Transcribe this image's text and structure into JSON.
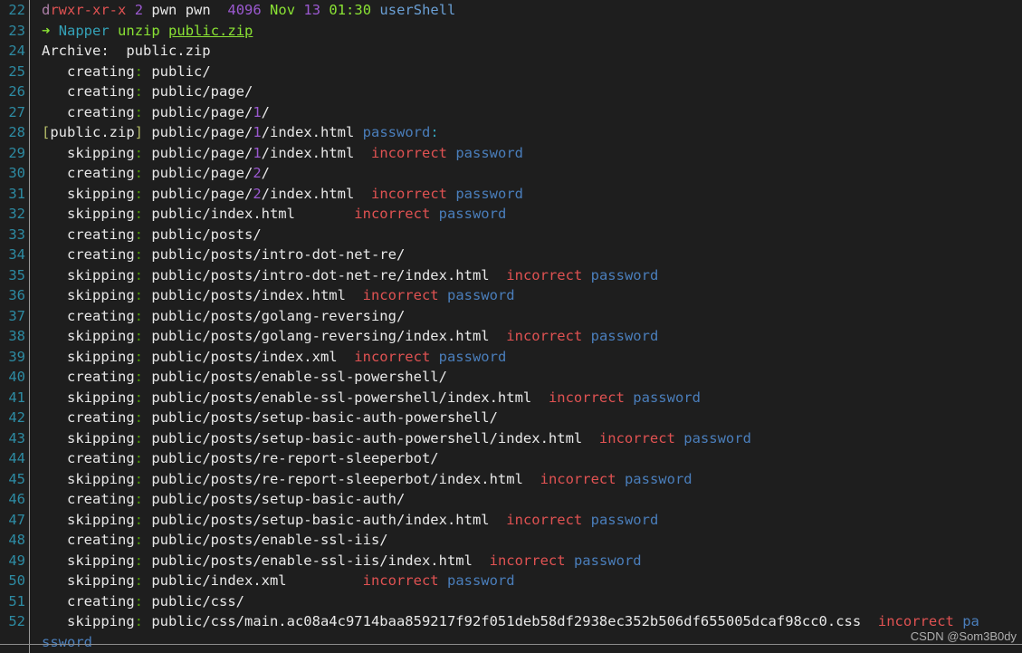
{
  "terminal": {
    "background_color": "#1e1e1e",
    "gutter_separator_color": "#9a9a9a",
    "line_number_color": "#2d8ba3",
    "watermark": "CSDN @Som3B0dy",
    "first_line_number": 22,
    "last_line_number": 52,
    "wrapped_remainder": "ssword",
    "prompt": {
      "arrow": "➜",
      "host": "Napper",
      "command": "unzip",
      "argument": "public.zip"
    },
    "lines": [
      {
        "n": "22",
        "type": "ls-listing",
        "segments": [
          {
            "t": "d",
            "c": "c-magenta"
          },
          {
            "t": "rwxr-xr-x",
            "c": "c-red"
          },
          {
            "t": " ",
            "c": "c-white"
          },
          {
            "t": "2",
            "c": "c-purple"
          },
          {
            "t": " pwn pwn  ",
            "c": "c-white"
          },
          {
            "t": "4096",
            "c": "c-purple"
          },
          {
            "t": " ",
            "c": "c-white"
          },
          {
            "t": "Nov",
            "c": "c-lgreen"
          },
          {
            "t": " ",
            "c": "c-white"
          },
          {
            "t": "13",
            "c": "c-purple"
          },
          {
            "t": " ",
            "c": "c-white"
          },
          {
            "t": "01:30",
            "c": "c-lgreen"
          },
          {
            "t": " ",
            "c": "c-white"
          },
          {
            "t": "userShell",
            "c": "c-lblue"
          }
        ]
      },
      {
        "n": "23",
        "type": "prompt",
        "segments": [
          {
            "t": "➜",
            "c": "c-lgreen"
          },
          {
            "t": " ",
            "c": "c-white"
          },
          {
            "t": "Napper",
            "c": "c-cyan"
          },
          {
            "t": " ",
            "c": "c-white"
          },
          {
            "t": "unzip",
            "c": "c-lgreen"
          },
          {
            "t": " ",
            "c": "c-white"
          },
          {
            "t": "public.zip",
            "c": "c-lgreen underline"
          }
        ]
      },
      {
        "n": "24",
        "type": "archive",
        "segments": [
          {
            "t": "Archive:  public.zip",
            "c": "c-white"
          }
        ]
      },
      {
        "n": "25",
        "type": "creating",
        "segments": [
          {
            "t": "   creating",
            "c": "c-white"
          },
          {
            "t": ":",
            "c": "c-green"
          },
          {
            "t": " public/",
            "c": "c-white"
          }
        ]
      },
      {
        "n": "26",
        "type": "creating",
        "segments": [
          {
            "t": "   creating",
            "c": "c-white"
          },
          {
            "t": ":",
            "c": "c-green"
          },
          {
            "t": " public/page/",
            "c": "c-white"
          }
        ]
      },
      {
        "n": "27",
        "type": "creating",
        "segments": [
          {
            "t": "   creating",
            "c": "c-white"
          },
          {
            "t": ":",
            "c": "c-green"
          },
          {
            "t": " public/page/",
            "c": "c-white"
          },
          {
            "t": "1",
            "c": "c-purple"
          },
          {
            "t": "/",
            "c": "c-white"
          }
        ]
      },
      {
        "n": "28",
        "type": "password-prompt",
        "segments": [
          {
            "t": "[",
            "c": "c-olive"
          },
          {
            "t": "public.zip",
            "c": "c-white"
          },
          {
            "t": "]",
            "c": "c-olive"
          },
          {
            "t": " public/page/",
            "c": "c-white"
          },
          {
            "t": "1",
            "c": "c-purple"
          },
          {
            "t": "/index.html ",
            "c": "c-white"
          },
          {
            "t": "password",
            "c": "c-blue"
          },
          {
            "t": ":",
            "c": "c-cyan"
          }
        ]
      },
      {
        "n": "29",
        "type": "skipping",
        "segments": [
          {
            "t": "   skipping",
            "c": "c-white"
          },
          {
            "t": ":",
            "c": "c-green"
          },
          {
            "t": " public/page/",
            "c": "c-white"
          },
          {
            "t": "1",
            "c": "c-purple"
          },
          {
            "t": "/index.html  ",
            "c": "c-white"
          },
          {
            "t": "incorrect",
            "c": "c-red"
          },
          {
            "t": " ",
            "c": "c-white"
          },
          {
            "t": "password",
            "c": "c-blue"
          }
        ]
      },
      {
        "n": "30",
        "type": "creating",
        "segments": [
          {
            "t": "   creating",
            "c": "c-white"
          },
          {
            "t": ":",
            "c": "c-green"
          },
          {
            "t": " public/page/",
            "c": "c-white"
          },
          {
            "t": "2",
            "c": "c-purple"
          },
          {
            "t": "/",
            "c": "c-white"
          }
        ]
      },
      {
        "n": "31",
        "type": "skipping",
        "segments": [
          {
            "t": "   skipping",
            "c": "c-white"
          },
          {
            "t": ":",
            "c": "c-green"
          },
          {
            "t": " public/page/",
            "c": "c-white"
          },
          {
            "t": "2",
            "c": "c-purple"
          },
          {
            "t": "/index.html  ",
            "c": "c-white"
          },
          {
            "t": "incorrect",
            "c": "c-red"
          },
          {
            "t": " ",
            "c": "c-white"
          },
          {
            "t": "password",
            "c": "c-blue"
          }
        ]
      },
      {
        "n": "32",
        "type": "skipping",
        "segments": [
          {
            "t": "   skipping",
            "c": "c-white"
          },
          {
            "t": ":",
            "c": "c-green"
          },
          {
            "t": " public/index.html       ",
            "c": "c-white"
          },
          {
            "t": "incorrect",
            "c": "c-red"
          },
          {
            "t": " ",
            "c": "c-white"
          },
          {
            "t": "password",
            "c": "c-blue"
          }
        ]
      },
      {
        "n": "33",
        "type": "creating",
        "segments": [
          {
            "t": "   creating",
            "c": "c-white"
          },
          {
            "t": ":",
            "c": "c-green"
          },
          {
            "t": " public/posts/",
            "c": "c-white"
          }
        ]
      },
      {
        "n": "34",
        "type": "creating",
        "segments": [
          {
            "t": "   creating",
            "c": "c-white"
          },
          {
            "t": ":",
            "c": "c-green"
          },
          {
            "t": " public/posts/intro-dot-net-re/",
            "c": "c-white"
          }
        ]
      },
      {
        "n": "35",
        "type": "skipping",
        "segments": [
          {
            "t": "   skipping",
            "c": "c-white"
          },
          {
            "t": ":",
            "c": "c-green"
          },
          {
            "t": " public/posts/intro-dot-net-re/index.html  ",
            "c": "c-white"
          },
          {
            "t": "incorrect",
            "c": "c-red"
          },
          {
            "t": " ",
            "c": "c-white"
          },
          {
            "t": "password",
            "c": "c-blue"
          }
        ]
      },
      {
        "n": "36",
        "type": "skipping",
        "segments": [
          {
            "t": "   skipping",
            "c": "c-white"
          },
          {
            "t": ":",
            "c": "c-green"
          },
          {
            "t": " public/posts/index.html  ",
            "c": "c-white"
          },
          {
            "t": "incorrect",
            "c": "c-red"
          },
          {
            "t": " ",
            "c": "c-white"
          },
          {
            "t": "password",
            "c": "c-blue"
          }
        ]
      },
      {
        "n": "37",
        "type": "creating",
        "segments": [
          {
            "t": "   creating",
            "c": "c-white"
          },
          {
            "t": ":",
            "c": "c-green"
          },
          {
            "t": " public/posts/golang-reversing/",
            "c": "c-white"
          }
        ]
      },
      {
        "n": "38",
        "type": "skipping",
        "segments": [
          {
            "t": "   skipping",
            "c": "c-white"
          },
          {
            "t": ":",
            "c": "c-green"
          },
          {
            "t": " public/posts/golang-reversing/index.html  ",
            "c": "c-white"
          },
          {
            "t": "incorrect",
            "c": "c-red"
          },
          {
            "t": " ",
            "c": "c-white"
          },
          {
            "t": "password",
            "c": "c-blue"
          }
        ]
      },
      {
        "n": "39",
        "type": "skipping",
        "segments": [
          {
            "t": "   skipping",
            "c": "c-white"
          },
          {
            "t": ":",
            "c": "c-green"
          },
          {
            "t": " public/posts/index.xml  ",
            "c": "c-white"
          },
          {
            "t": "incorrect",
            "c": "c-red"
          },
          {
            "t": " ",
            "c": "c-white"
          },
          {
            "t": "password",
            "c": "c-blue"
          }
        ]
      },
      {
        "n": "40",
        "type": "creating",
        "segments": [
          {
            "t": "   creating",
            "c": "c-white"
          },
          {
            "t": ":",
            "c": "c-green"
          },
          {
            "t": " public/posts/enable-ssl-powershell/",
            "c": "c-white"
          }
        ]
      },
      {
        "n": "41",
        "type": "skipping",
        "segments": [
          {
            "t": "   skipping",
            "c": "c-white"
          },
          {
            "t": ":",
            "c": "c-green"
          },
          {
            "t": " public/posts/enable-ssl-powershell/index.html  ",
            "c": "c-white"
          },
          {
            "t": "incorrect",
            "c": "c-red"
          },
          {
            "t": " ",
            "c": "c-white"
          },
          {
            "t": "password",
            "c": "c-blue"
          }
        ]
      },
      {
        "n": "42",
        "type": "creating",
        "segments": [
          {
            "t": "   creating",
            "c": "c-white"
          },
          {
            "t": ":",
            "c": "c-green"
          },
          {
            "t": " public/posts/setup-basic-auth-powershell/",
            "c": "c-white"
          }
        ]
      },
      {
        "n": "43",
        "type": "skipping",
        "segments": [
          {
            "t": "   skipping",
            "c": "c-white"
          },
          {
            "t": ":",
            "c": "c-green"
          },
          {
            "t": " public/posts/setup-basic-auth-powershell/index.html  ",
            "c": "c-white"
          },
          {
            "t": "incorrect",
            "c": "c-red"
          },
          {
            "t": " ",
            "c": "c-white"
          },
          {
            "t": "password",
            "c": "c-blue"
          }
        ]
      },
      {
        "n": "44",
        "type": "creating",
        "segments": [
          {
            "t": "   creating",
            "c": "c-white"
          },
          {
            "t": ":",
            "c": "c-green"
          },
          {
            "t": " public/posts/re-report-sleeperbot/",
            "c": "c-white"
          }
        ]
      },
      {
        "n": "45",
        "type": "skipping",
        "segments": [
          {
            "t": "   skipping",
            "c": "c-white"
          },
          {
            "t": ":",
            "c": "c-green"
          },
          {
            "t": " public/posts/re-report-sleeperbot/index.html  ",
            "c": "c-white"
          },
          {
            "t": "incorrect",
            "c": "c-red"
          },
          {
            "t": " ",
            "c": "c-white"
          },
          {
            "t": "password",
            "c": "c-blue"
          }
        ]
      },
      {
        "n": "46",
        "type": "creating",
        "segments": [
          {
            "t": "   creating",
            "c": "c-white"
          },
          {
            "t": ":",
            "c": "c-green"
          },
          {
            "t": " public/posts/setup-basic-auth/",
            "c": "c-white"
          }
        ]
      },
      {
        "n": "47",
        "type": "skipping",
        "segments": [
          {
            "t": "   skipping",
            "c": "c-white"
          },
          {
            "t": ":",
            "c": "c-green"
          },
          {
            "t": " public/posts/setup-basic-auth/index.html  ",
            "c": "c-white"
          },
          {
            "t": "incorrect",
            "c": "c-red"
          },
          {
            "t": " ",
            "c": "c-white"
          },
          {
            "t": "password",
            "c": "c-blue"
          }
        ]
      },
      {
        "n": "48",
        "type": "creating",
        "segments": [
          {
            "t": "   creating",
            "c": "c-white"
          },
          {
            "t": ":",
            "c": "c-green"
          },
          {
            "t": " public/posts/enable-ssl-iis/",
            "c": "c-white"
          }
        ]
      },
      {
        "n": "49",
        "type": "skipping",
        "segments": [
          {
            "t": "   skipping",
            "c": "c-white"
          },
          {
            "t": ":",
            "c": "c-green"
          },
          {
            "t": " public/posts/enable-ssl-iis/index.html  ",
            "c": "c-white"
          },
          {
            "t": "incorrect",
            "c": "c-red"
          },
          {
            "t": " ",
            "c": "c-white"
          },
          {
            "t": "password",
            "c": "c-blue"
          }
        ]
      },
      {
        "n": "50",
        "type": "skipping",
        "segments": [
          {
            "t": "   skipping",
            "c": "c-white"
          },
          {
            "t": ":",
            "c": "c-green"
          },
          {
            "t": " public/index.xml         ",
            "c": "c-white"
          },
          {
            "t": "incorrect",
            "c": "c-red"
          },
          {
            "t": " ",
            "c": "c-white"
          },
          {
            "t": "password",
            "c": "c-blue"
          }
        ]
      },
      {
        "n": "51",
        "type": "creating",
        "segments": [
          {
            "t": "   creating",
            "c": "c-white"
          },
          {
            "t": ":",
            "c": "c-green"
          },
          {
            "t": " public/css/",
            "c": "c-white"
          }
        ]
      },
      {
        "n": "52",
        "type": "skipping",
        "segments": [
          {
            "t": "   skipping",
            "c": "c-white"
          },
          {
            "t": ":",
            "c": "c-green"
          },
          {
            "t": " public/css/main.ac08a4c9714baa859217f92f051deb58df2938ec352b506df655005dcaf98cc0.css  ",
            "c": "c-white"
          },
          {
            "t": "incorrect",
            "c": "c-red"
          },
          {
            "t": " ",
            "c": "c-white"
          },
          {
            "t": "pa",
            "c": "c-blue"
          }
        ]
      }
    ]
  }
}
